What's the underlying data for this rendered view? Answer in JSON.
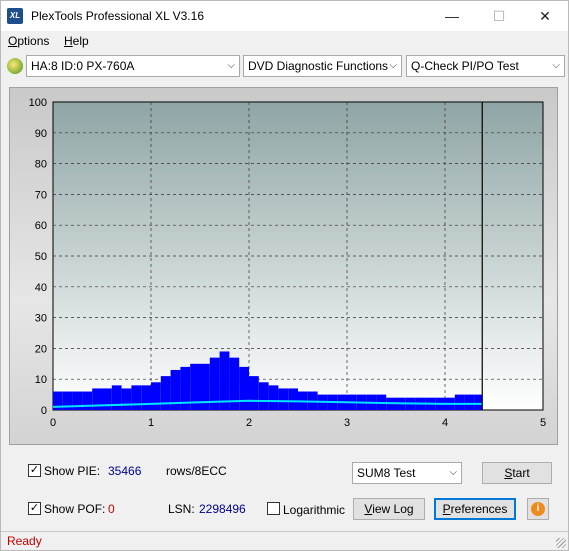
{
  "window": {
    "title": "PlexTools Professional XL V3.16",
    "icon_text": "XL"
  },
  "menu": {
    "options": "Options",
    "options_key": "O",
    "options_rest": "ptions",
    "help_key": "H",
    "help_rest": "elp"
  },
  "toolbar": {
    "drive": "HA:8 ID:0  PX-760A",
    "function": "DVD Diagnostic Functions",
    "test": "Q-Check PI/PO Test"
  },
  "chart_data": {
    "type": "area",
    "x_ticks": [
      "0",
      "1",
      "2",
      "3",
      "4",
      "5"
    ],
    "y_ticks": [
      "0",
      "10",
      "20",
      "30",
      "40",
      "50",
      "60",
      "70",
      "80",
      "90",
      "100"
    ],
    "xlim": [
      0,
      5
    ],
    "ylim": [
      0,
      100
    ],
    "end_marker_x": 4.38,
    "grid": true,
    "colors": {
      "bars": "#0000ff",
      "average_line": "#00e5ff",
      "plot_bg_top": "#8fa5a5",
      "plot_bg_bottom": "#ffffff",
      "grid": "#333333"
    },
    "series": [
      {
        "type": "bar",
        "color": "#0000ff",
        "x": [
          0.0,
          0.1,
          0.2,
          0.3,
          0.4,
          0.5,
          0.6,
          0.7,
          0.8,
          0.9,
          1.0,
          1.1,
          1.2,
          1.3,
          1.4,
          1.5,
          1.6,
          1.7,
          1.8,
          1.9,
          2.0,
          2.1,
          2.2,
          2.3,
          2.4,
          2.5,
          2.6,
          2.7,
          2.8,
          2.9,
          3.0,
          3.1,
          3.2,
          3.3,
          3.4,
          3.5,
          3.6,
          3.7,
          3.8,
          3.9,
          4.0,
          4.1,
          4.2,
          4.3
        ],
        "values": [
          6,
          6,
          6,
          6,
          7,
          7,
          8,
          7,
          8,
          8,
          9,
          11,
          13,
          14,
          15,
          15,
          17,
          19,
          17,
          14,
          11,
          9,
          8,
          7,
          7,
          6,
          6,
          5,
          5,
          5,
          5,
          5,
          5,
          5,
          4,
          4,
          4,
          4,
          4,
          4,
          4,
          5,
          5,
          5
        ]
      },
      {
        "type": "line",
        "color": "#00e5ff",
        "x": [
          0.0,
          0.5,
          1.0,
          1.5,
          2.0,
          2.5,
          3.0,
          3.5,
          4.0,
          4.38
        ],
        "values": [
          1,
          1.5,
          2,
          2.5,
          3,
          2.8,
          2.5,
          2.2,
          2,
          2
        ]
      }
    ]
  },
  "controls": {
    "show_pie_label": "Show PIE:",
    "show_pie_checked": "✓",
    "pie_value": "35466",
    "pie_unit": "rows/8ECC",
    "show_pof_label": "Show POF:",
    "show_pof_checked": "✓",
    "pof_value": "0",
    "lsn_label": "LSN:",
    "lsn_value": "2298496",
    "logarithmic_label": "Logarithmic",
    "test_mode": "SUM8 Test",
    "start_button": "Start",
    "view_log_button": "View Log",
    "preferences_button": "Preferences",
    "info_icon": "info-icon"
  },
  "status": {
    "text": "Ready"
  }
}
